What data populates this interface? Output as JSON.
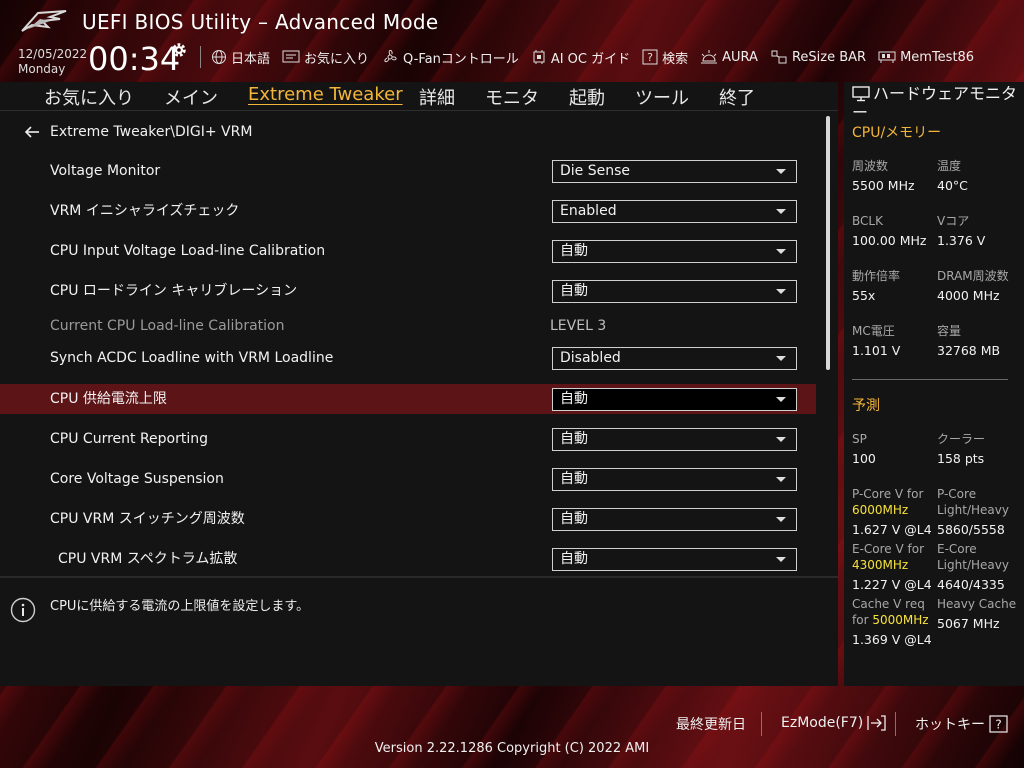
{
  "header": {
    "title": "UEFI BIOS Utility – Advanced Mode",
    "date": "12/05/2022",
    "weekday": "Monday",
    "time": "00:34"
  },
  "toolbar": [
    {
      "label": "日本語",
      "icon": "globe-icon"
    },
    {
      "label": "お気に入り",
      "icon": "favorites-icon"
    },
    {
      "label": "Q-Fanコントロール",
      "icon": "fan-icon"
    },
    {
      "label": "AI OC ガイド",
      "icon": "ai-chip-icon"
    },
    {
      "label": "検索",
      "icon": "search-help-icon"
    },
    {
      "label": "AURA",
      "icon": "aura-icon"
    },
    {
      "label": "ReSize BAR",
      "icon": "resize-bar-icon"
    },
    {
      "label": "MemTest86",
      "icon": "memtest-icon"
    }
  ],
  "nav": [
    {
      "label": "お気に入り",
      "active": false
    },
    {
      "label": "メイン",
      "active": false
    },
    {
      "label": "Extreme Tweaker",
      "active": true
    },
    {
      "label": "詳細",
      "active": false
    },
    {
      "label": "モニタ",
      "active": false
    },
    {
      "label": "起動",
      "active": false
    },
    {
      "label": "ツール",
      "active": false
    },
    {
      "label": "終了",
      "active": false
    }
  ],
  "breadcrumb": "Extreme Tweaker\\DIGI+ VRM",
  "settings": [
    {
      "label": "Voltage Monitor",
      "value": "Die Sense",
      "type": "dropdown"
    },
    {
      "label": "VRM イニシャライズチェック",
      "value": "Enabled",
      "type": "dropdown"
    },
    {
      "label": "CPU Input Voltage Load-line Calibration",
      "value": "自動",
      "type": "dropdown"
    },
    {
      "label": "CPU ロードライン キャリブレーション",
      "value": "自動",
      "type": "dropdown"
    },
    {
      "label": "Current CPU Load-line Calibration",
      "value": "LEVEL 3",
      "type": "readonly"
    },
    {
      "label": "Synch ACDC Loadline with VRM Loadline",
      "value": "Disabled",
      "type": "dropdown"
    },
    {
      "label": "CPU 供給電流上限",
      "value": "自動",
      "type": "dropdown",
      "selected": true
    },
    {
      "label": "CPU Current Reporting",
      "value": "自動",
      "type": "dropdown"
    },
    {
      "label": "Core Voltage Suspension",
      "value": "自動",
      "type": "dropdown"
    },
    {
      "label": "CPU VRM スイッチング周波数",
      "value": "自動",
      "type": "dropdown"
    },
    {
      "label": "CPU VRM スペクトラム拡散",
      "value": "自動",
      "type": "dropdown",
      "indent": true
    }
  ],
  "help_text": "CPUに供給する電流の上限値を設定します。",
  "monitor": {
    "title": "ハードウェアモニター",
    "cpu_section": "CPU/メモリー",
    "cpu": [
      {
        "label": "周波数",
        "value": "5500 MHz"
      },
      {
        "label": "温度",
        "value": "40°C"
      },
      {
        "label": "BCLK",
        "value": "100.00 MHz"
      },
      {
        "label": "Vコア",
        "value": "1.376 V"
      },
      {
        "label": "動作倍率",
        "value": "55x"
      },
      {
        "label": "DRAM周波数",
        "value": "4000 MHz"
      },
      {
        "label": "MC電圧",
        "value": "1.101 V"
      },
      {
        "label": "容量",
        "value": "32768 MB"
      }
    ],
    "predict_section": "予測",
    "predict": {
      "sp_label": "SP",
      "sp_value": "100",
      "cooler_label": "クーラー",
      "cooler_value": "158 pts",
      "pcore_v_label": "P-Core V for",
      "pcore_v_freq": "6000MHz",
      "pcore_v_value": "1.627 V @L4",
      "pcore_lh_label1": "P-Core",
      "pcore_lh_label2": "Light/Heavy",
      "pcore_lh_value": "5860/5558",
      "ecore_v_label": "E-Core V for",
      "ecore_v_freq": "4300MHz",
      "ecore_v_value": "1.227 V @L4",
      "ecore_lh_label1": "E-Core",
      "ecore_lh_label2": "Light/Heavy",
      "ecore_lh_value": "4640/4335",
      "cache_v_label1": "Cache V req",
      "cache_v_label2": "for",
      "cache_v_freq": "5000MHz",
      "cache_v_value": "1.369 V @L4",
      "heavy_cache_label": "Heavy Cache",
      "heavy_cache_value": "5067 MHz"
    }
  },
  "footer": {
    "last_modified": "最終更新日",
    "ezmode": "EzMode(F7)",
    "hotkey": "ホットキー",
    "version": "Version 2.22.1286 Copyright (C) 2022 AMI"
  },
  "colors": {
    "accent": "#f4b63a",
    "highlight": "#f7e23a",
    "selected_row": "#5c1417",
    "panel_bg": "#141414"
  }
}
